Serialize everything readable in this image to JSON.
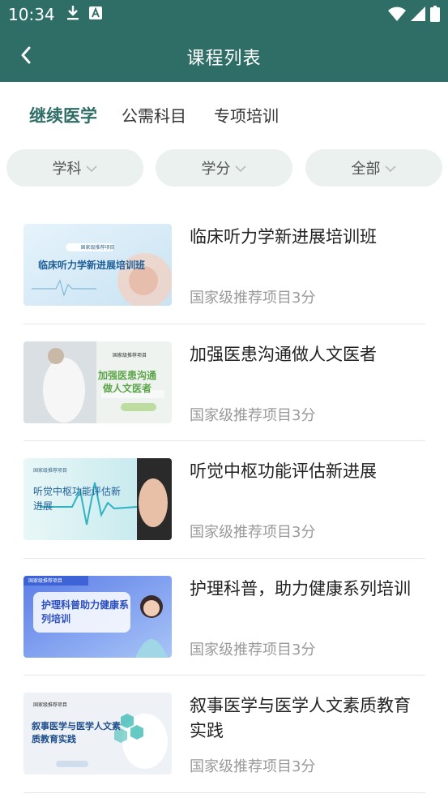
{
  "status_bar": {
    "time": "10:34"
  },
  "nav": {
    "title": "课程列表"
  },
  "tabs": [
    {
      "label": "继续医学",
      "active": true
    },
    {
      "label": "公需科目",
      "active": false
    },
    {
      "label": "专项培训",
      "active": false
    }
  ],
  "filters": [
    {
      "label": "学科"
    },
    {
      "label": "学分"
    },
    {
      "label": "全部"
    }
  ],
  "courses": [
    {
      "title": "临床听力学新进展培训班",
      "meta": "国家级推荐项目3分",
      "thumb_text": "临床听力学新进展培训班",
      "thumb_tag": "国家级推荐项目"
    },
    {
      "title": "加强医患沟通做人文医者",
      "meta": "国家级推荐项目3分",
      "thumb_text": "加强医患沟通做人文医者",
      "thumb_tag": "国家级推荐项目"
    },
    {
      "title": "听觉中枢功能评估新进展",
      "meta": "国家级推荐项目3分",
      "thumb_text": "听觉中枢功能评估新进展",
      "thumb_tag": "国家级推荐项目"
    },
    {
      "title": "护理科普，助力健康系列培训",
      "meta": "国家级推荐项目3分",
      "thumb_text": "护理科普助力健康系列培训",
      "thumb_tag": "国家级推荐项目"
    },
    {
      "title": "叙事医学与医学人文素质教育实践",
      "meta": "国家级推荐项目3分",
      "thumb_text": "叙事医学与医学人文素质教育实践",
      "thumb_tag": "国家级推荐项目"
    }
  ],
  "colors": {
    "primary": "#2f6e66",
    "pill_bg": "#eaf1ef",
    "meta_text": "#9a9a9a"
  }
}
